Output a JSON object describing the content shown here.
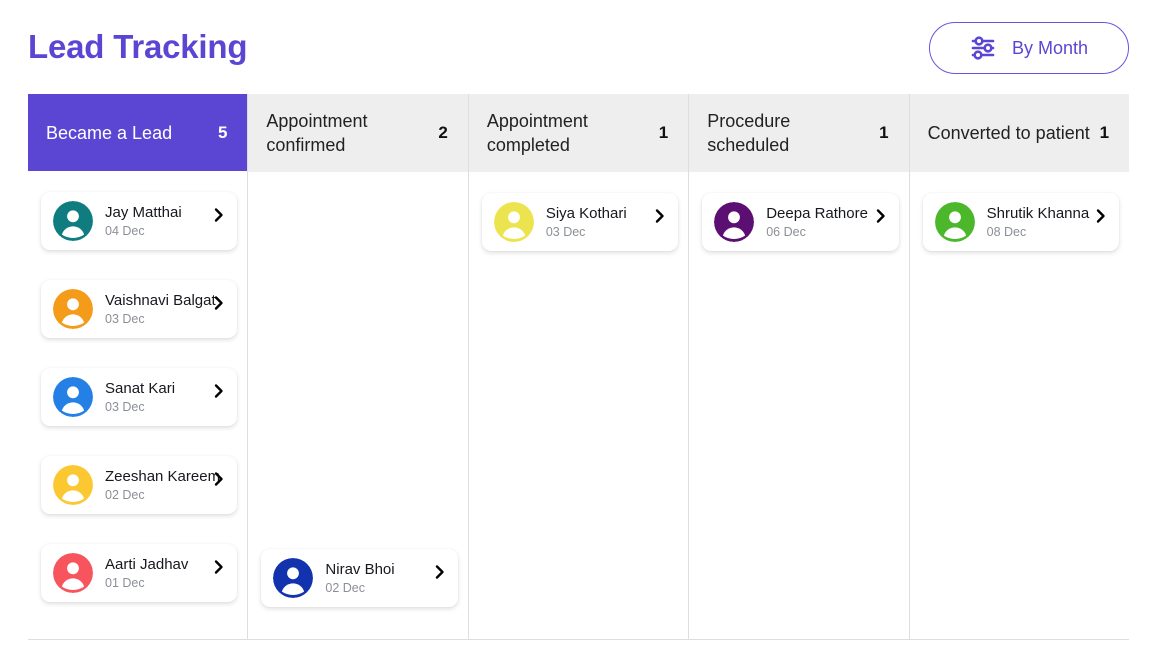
{
  "header": {
    "title": "Lead Tracking",
    "title_color": "#5b46d4",
    "filter_button": {
      "label": "By Month",
      "icon": "sliders-filter-icon",
      "accent_color": "#5b46d4"
    }
  },
  "board": {
    "columns": [
      {
        "id": "became-a-lead",
        "title": "Became a Lead",
        "count": "5",
        "active": true,
        "header_bg": "#5b46d4",
        "header_fg": "#ffffff",
        "cards": [
          {
            "name": "Jay Matthai",
            "date": "04 Dec",
            "avatar_color": "#0f7c80"
          },
          {
            "name": "Vaishnavi Balgat",
            "date": "03 Dec",
            "avatar_color": "#f59b1a"
          },
          {
            "name": "Sanat Kari",
            "date": "03 Dec",
            "avatar_color": "#2480e4"
          },
          {
            "name": "Zeeshan Kareem",
            "date": "02 Dec",
            "avatar_color": "#fbc832"
          },
          {
            "name": "Aarti Jadhav",
            "date": "01 Dec",
            "avatar_color": "#f8545e"
          }
        ]
      },
      {
        "id": "appointment-confirmed",
        "title": "Appointment confirmed",
        "count": "2",
        "active": false,
        "header_bg": "#eeeeee",
        "header_fg": "#222222",
        "cards": [
          {
            "name": "Nirav Bhoi",
            "date": "02 Dec",
            "avatar_color": "#1232ae",
            "pushed": true
          }
        ]
      },
      {
        "id": "appointment-completed",
        "title": "Appointment completed",
        "count": "1",
        "active": false,
        "header_bg": "#eeeeee",
        "header_fg": "#222222",
        "cards": [
          {
            "name": "Siya Kothari",
            "date": "03 Dec",
            "avatar_color": "#ece44e"
          }
        ]
      },
      {
        "id": "procedure-scheduled",
        "title": "Procedure scheduled",
        "count": "1",
        "active": false,
        "header_bg": "#eeeeee",
        "header_fg": "#222222",
        "cards": [
          {
            "name": "Deepa Rathore",
            "date": "06 Dec",
            "avatar_color": "#5c0f72"
          }
        ]
      },
      {
        "id": "converted-to-patient",
        "title": "Converted to patient",
        "count": "1",
        "active": false,
        "header_bg": "#eeeeee",
        "header_fg": "#222222",
        "cards": [
          {
            "name": "Shrutik Khanna",
            "date": "08 Dec",
            "avatar_color": "#4cb72b"
          }
        ]
      }
    ]
  },
  "icons": {
    "avatar": "user-avatar-icon",
    "chevron": "chevron-right-icon"
  }
}
